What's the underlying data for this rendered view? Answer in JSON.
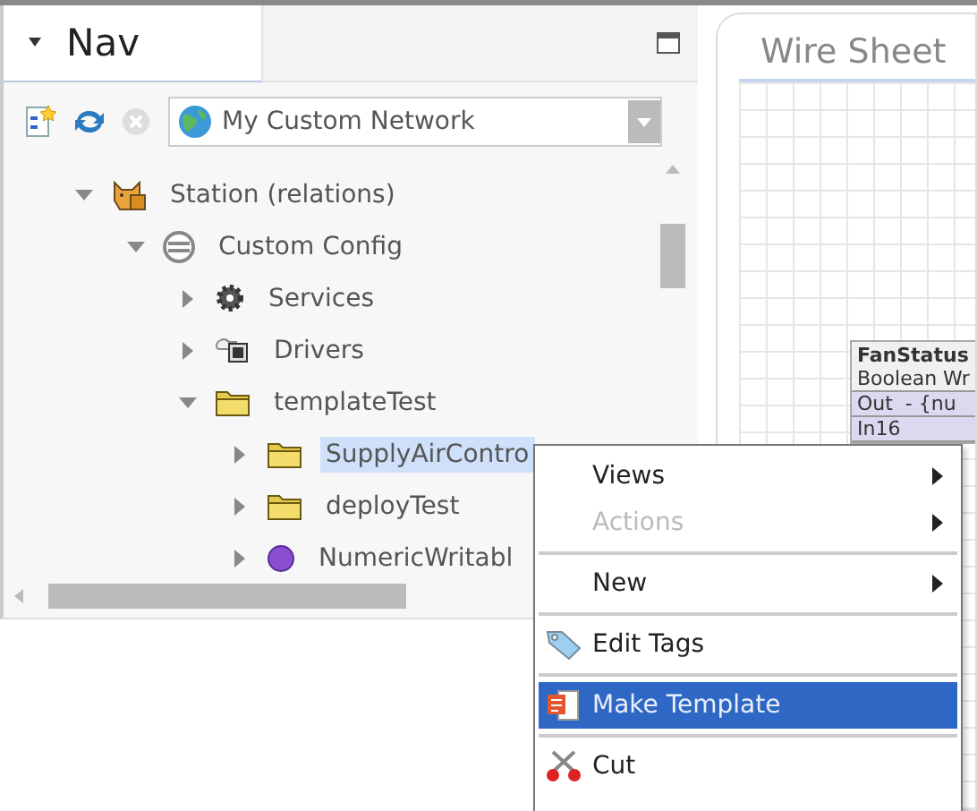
{
  "nav": {
    "title": "Nav",
    "network": "My Custom Network"
  },
  "tree": [
    {
      "label": "Station (relations)",
      "kind": "station",
      "expanded": true,
      "selected": false,
      "children": [
        {
          "label": "Custom Config",
          "kind": "database",
          "expanded": true,
          "selected": false,
          "children": [
            {
              "label": "Services",
              "kind": "gear",
              "expanded": false,
              "selected": false
            },
            {
              "label": "Drivers",
              "kind": "driver",
              "expanded": false,
              "selected": false
            },
            {
              "label": "templateTest",
              "kind": "folder",
              "expanded": true,
              "selected": false,
              "children": [
                {
                  "label": "SupplyAirContro",
                  "kind": "folder",
                  "expanded": false,
                  "selected": true
                },
                {
                  "label": "deployTest",
                  "kind": "folder",
                  "expanded": false,
                  "selected": false
                },
                {
                  "label": "NumericWritabl",
                  "kind": "point",
                  "expanded": false,
                  "selected": false
                }
              ]
            }
          ]
        }
      ]
    }
  ],
  "wire_sheet": {
    "title": "Wire Sheet",
    "block": {
      "name": "FanStatus",
      "type": "Boolean Wr",
      "slots": [
        "Out  - {nu",
        "In16"
      ]
    }
  },
  "context_menu": [
    {
      "kind": "plain",
      "label": "Views",
      "submenu": true,
      "disabled": false,
      "selected": false
    },
    {
      "kind": "plain",
      "label": "Actions",
      "submenu": true,
      "disabled": true,
      "selected": false
    },
    {
      "kind": "separator"
    },
    {
      "kind": "plain",
      "label": "New",
      "submenu": true,
      "disabled": false,
      "selected": false
    },
    {
      "kind": "separator"
    },
    {
      "kind": "tag",
      "label": "Edit Tags",
      "submenu": false,
      "disabled": false,
      "selected": false
    },
    {
      "kind": "separator"
    },
    {
      "kind": "template",
      "label": "Make Template",
      "submenu": false,
      "disabled": false,
      "selected": true
    },
    {
      "kind": "separator"
    },
    {
      "kind": "scissors",
      "label": "Cut",
      "submenu": false,
      "disabled": false,
      "selected": false
    }
  ]
}
